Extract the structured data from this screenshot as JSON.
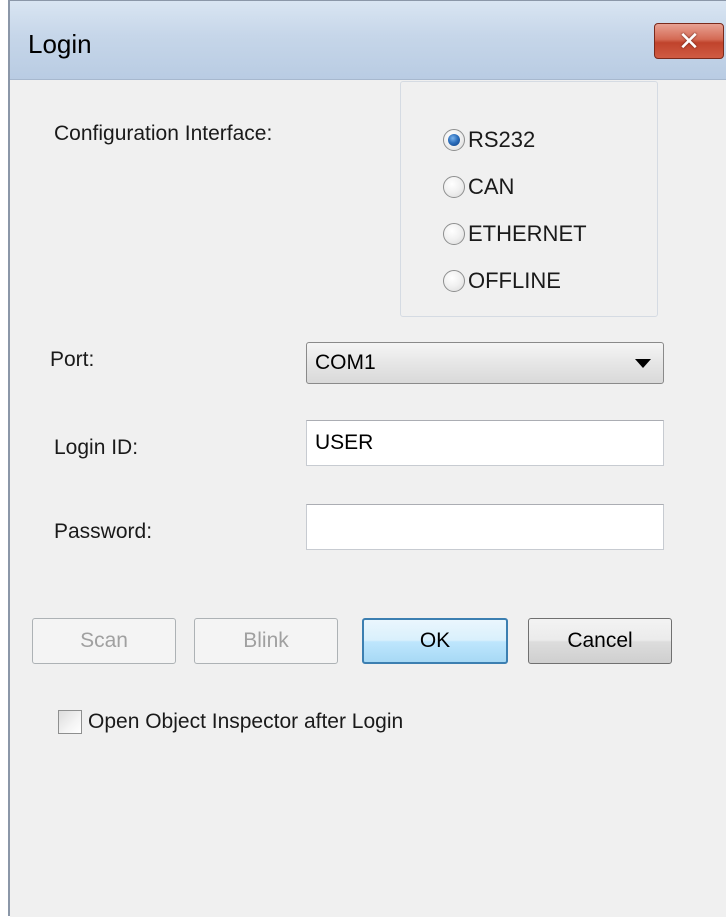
{
  "window": {
    "title": "Login",
    "close_glyph": "✕"
  },
  "form": {
    "config_interface_label": "Configuration Interface:",
    "interfaces": [
      {
        "label": "RS232",
        "selected": true
      },
      {
        "label": "CAN",
        "selected": false
      },
      {
        "label": "ETHERNET",
        "selected": false
      },
      {
        "label": "OFFLINE",
        "selected": false
      }
    ],
    "port_label": "Port:",
    "port_value": "COM1",
    "login_id_label": "Login ID:",
    "login_id_value": "USER",
    "password_label": "Password:",
    "password_value": ""
  },
  "buttons": {
    "scan": "Scan",
    "blink": "Blink",
    "ok": "OK",
    "cancel": "Cancel"
  },
  "options": {
    "open_inspector_label": "Open Object Inspector after Login",
    "open_inspector_checked": false
  },
  "colors": {
    "title_bar": "#c6d6e9",
    "close_button": "#c0432c",
    "radio_selected": "#2c6fbd",
    "default_button_border": "#3c7fb1"
  }
}
